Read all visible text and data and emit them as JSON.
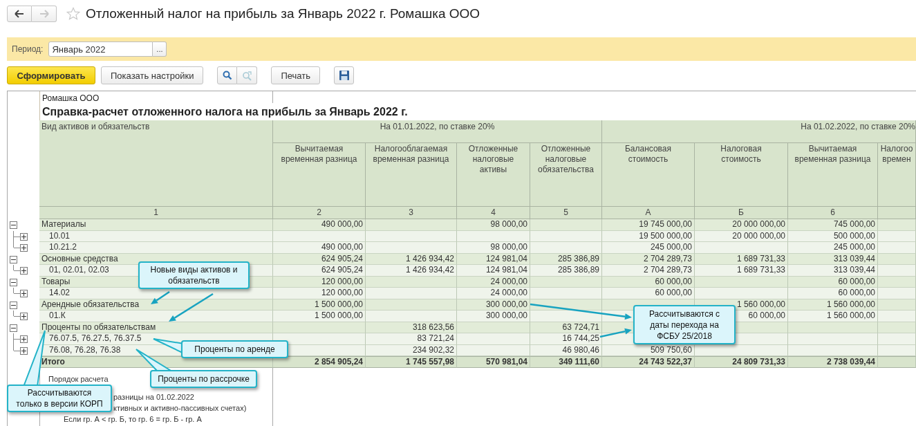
{
  "window": {
    "title": "Отложенный налог на прибыль за Январь 2022 г. Ромашка ООО",
    "favorite": false
  },
  "nav": {
    "back": {
      "disabled": false
    },
    "forward": {
      "disabled": true
    }
  },
  "period": {
    "label": "Период:",
    "value": "Январь 2022",
    "picker": "..."
  },
  "toolbar": [
    [
      {
        "kind": "primary",
        "label": "Сформировать"
      },
      {
        "kind": "text",
        "label": "Показать настройки"
      }
    ],
    [
      {
        "kind": "search",
        "disabled": false
      },
      {
        "kind": "search-refresh",
        "disabled": true
      }
    ],
    [
      {
        "kind": "text",
        "label": "Печать"
      }
    ],
    [
      {
        "kind": "save",
        "disabled": false
      }
    ]
  ],
  "report": {
    "org": "Ромашка ООО",
    "title": "Справка-расчет отложенного налога на прибыль за Январь 2022 г.",
    "row_header": "Вид активов и обязательств",
    "row_header_number": "1",
    "groups": [
      {
        "label": "На 01.01.2022, по ставке 20%",
        "columns": [
          {
            "label": "Вычитаемая\nвременная разница",
            "number": "2"
          },
          {
            "label": "Налогооблагаемая\nвременная разница",
            "number": "3"
          },
          {
            "label": "Отложенные\nналоговые\nактивы",
            "number": "4"
          },
          {
            "label": "Отложенные\nналоговые\nобязательства",
            "number": "5"
          }
        ]
      },
      {
        "label": "На 01.02.2022, по ставке 20%",
        "columns": [
          {
            "label": "Балансовая\nстоимость",
            "number": "А"
          },
          {
            "label": "Налоговая\nстоимость",
            "number": "Б"
          },
          {
            "label": "Вычитаемая\nвременная разница",
            "number": "6"
          },
          {
            "label": "Налогоо\nвремен"
          }
        ]
      }
    ],
    "rows": [
      {
        "label": "Материалы",
        "expanded": true,
        "values": {
          "col_2": "490 000,00",
          "col_4": "98 000,00",
          "col_a": "19 745 000,00",
          "col_b": "20 000 000,00",
          "col_6": "745 000,00"
        },
        "children": [
          {
            "label": "10.01",
            "expanded": false,
            "values": {
              "col_a": "19 500 000,00",
              "col_b": "20 000 000,00",
              "col_6": "500 000,00"
            }
          },
          {
            "label": "10.21.2",
            "expanded": false,
            "values": {
              "col_2": "490 000,00",
              "col_4": "98 000,00",
              "col_a": "245 000,00",
              "col_6": "245 000,00"
            }
          }
        ]
      },
      {
        "label": "Основные средства",
        "expanded": true,
        "values": {
          "col_2": "624 905,24",
          "col_3": "1 426 934,42",
          "col_4": "124 981,04",
          "col_5": "285 386,89",
          "col_a": "2 704 289,73",
          "col_b": "1 689 731,33",
          "col_6": "313 039,44"
        },
        "children": [
          {
            "label": "01, 02.01, 02.03",
            "expanded": false,
            "values": {
              "col_2": "624 905,24",
              "col_3": "1 426 934,42",
              "col_4": "124 981,04",
              "col_5": "285 386,89",
              "col_a": "2 704 289,73",
              "col_b": "1 689 731,33",
              "col_6": "313 039,44"
            }
          }
        ]
      },
      {
        "label": "Товары",
        "expanded": true,
        "values": {
          "col_2": "120 000,00",
          "col_4": "24 000,00",
          "col_a": "60 000,00",
          "col_6": "60 000,00"
        },
        "children": [
          {
            "label": "14.02",
            "expanded": false,
            "values": {
              "col_2": "120 000,00",
              "col_4": "24 000,00",
              "col_a": "60 000,00",
              "col_6": "60 000,00"
            }
          }
        ]
      },
      {
        "label": "Арендные обязательства",
        "expanded": true,
        "values": {
          "col_2": "1 500 000,00",
          "col_4": "300 000,00",
          "col_b": "1 560 000,00",
          "col_6": "1 560 000,00"
        },
        "children": [
          {
            "label": "01.К",
            "expanded": false,
            "values": {
              "col_2": "1 500 000,00",
              "col_4": "300 000,00",
              "col_b": "60 000,00",
              "col_6": "1 560 000,00"
            }
          }
        ]
      },
      {
        "label": "Проценты по обязательствам",
        "expanded": true,
        "values": {
          "col_3": "318 623,56",
          "col_5": "63 724,71"
        },
        "children": [
          {
            "label": "76.07.5, 76.27.5, 76.37.5",
            "expanded": false,
            "values": {
              "col_3": "83 721,24",
              "col_5": "16 744,25"
            }
          },
          {
            "label": "76.08, 76.28, 76.38",
            "expanded": false,
            "values": {
              "col_3": "234 902,32",
              "col_5": "46 980,46",
              "col_a": "509 750,60"
            }
          }
        ]
      }
    ],
    "total": {
      "label": "Итого",
      "values": {
        "col_2": "2 854 905,24",
        "col_3": "1 745 557,98",
        "col_4": "570 981,04",
        "col_5": "349 111,60",
        "col_a": "24 743 522,37",
        "col_b": "24 809 731,33",
        "col_6": "2 738 039,44"
      }
    },
    "notes": [
      {
        "kind": "heading",
        "text": "Порядок расчета"
      },
      {
        "kind": "partial",
        "text": "разницы на 01.02.2022"
      },
      {
        "kind": "partial",
        "text": "ктивных и активно-пассивных счетах)"
      },
      {
        "kind": "rule",
        "text": "Если гр. А < гр. Б, то гр. 6 = гр. Б - гр. А"
      }
    ]
  },
  "callouts": [
    {
      "text": "Новые виды активов и\nобязательств"
    },
    {
      "text": "Проценты по аренде"
    },
    {
      "text": "Проценты по рассрочке"
    },
    {
      "text": "Рассчитываются\nтолько в версии КОРП"
    },
    {
      "text": "Рассчитываются с\nдаты перехода на\nФСБУ 25/2018"
    }
  ]
}
